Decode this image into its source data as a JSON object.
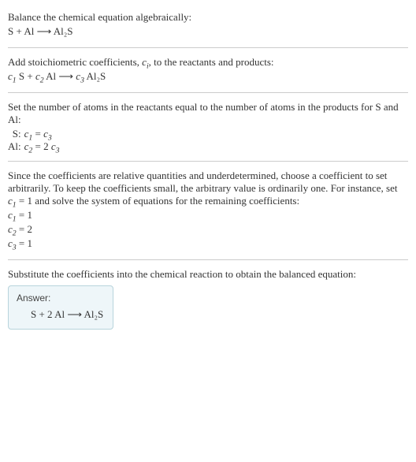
{
  "section1": {
    "line1": "Balance the chemical equation algebraically:",
    "eq": "S + Al ⟶ Al₂S"
  },
  "section2": {
    "line1_a": "Add stoichiometric coefficients, ",
    "line1_ci": "c",
    "line1_ci_sub": "i",
    "line1_b": ", to the reactants and products:",
    "eq_c1": "c",
    "eq_c1_sub": "1",
    "eq_r1": " S + ",
    "eq_c2": "c",
    "eq_c2_sub": "2",
    "eq_r2": " Al ⟶ ",
    "eq_c3": "c",
    "eq_c3_sub": "3",
    "eq_r3": " Al₂S"
  },
  "section3": {
    "line1": "Set the number of atoms in the reactants equal to the number of atoms in the products for S and Al:",
    "rows": [
      {
        "label": " S:",
        "lhs_c": "c",
        "lhs_sub": "1",
        "mid": " = ",
        "rhs_pre": "",
        "rhs_c": "c",
        "rhs_sub": "3"
      },
      {
        "label": "Al:",
        "lhs_c": "c",
        "lhs_sub": "2",
        "mid": " = ",
        "rhs_pre": "2 ",
        "rhs_c": "c",
        "rhs_sub": "3"
      }
    ]
  },
  "section4": {
    "line1_a": "Since the coefficients are relative quantities and underdetermined, choose a coefficient to set arbitrarily. To keep the coefficients small, the arbitrary value is ordinarily one. For instance, set ",
    "line1_c": "c",
    "line1_c_sub": "1",
    "line1_b": " = 1 and solve the system of equations for the remaining coefficients:",
    "sol": [
      {
        "c": "c",
        "sub": "1",
        "val": " = 1"
      },
      {
        "c": "c",
        "sub": "2",
        "val": " = 2"
      },
      {
        "c": "c",
        "sub": "3",
        "val": " = 1"
      }
    ]
  },
  "section5": {
    "line1": "Substitute the coefficients into the chemical reaction to obtain the balanced equation:",
    "answer_label": "Answer:",
    "answer_eq": "S + 2 Al ⟶ Al₂S"
  }
}
